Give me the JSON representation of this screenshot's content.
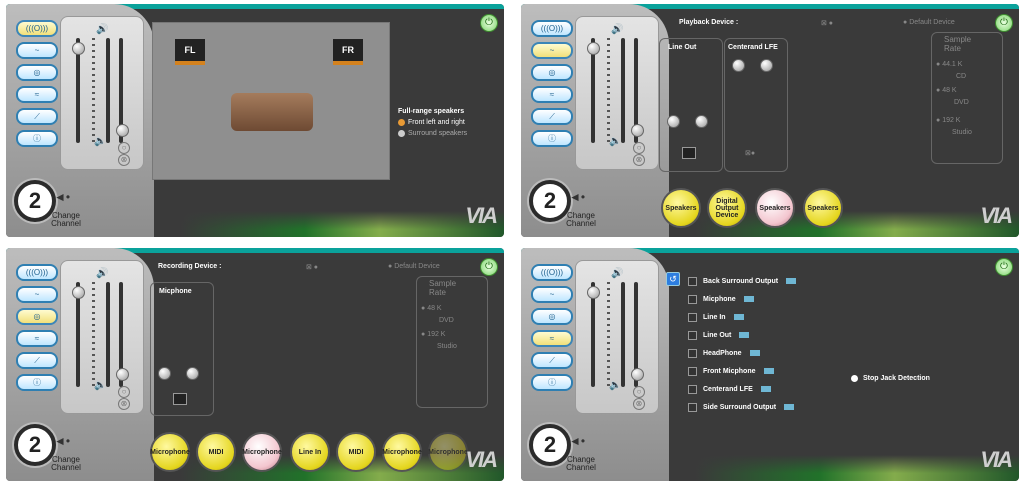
{
  "nav": [
    "(((O)))",
    "~",
    "◎",
    "≈",
    "⟋",
    "ⓘ"
  ],
  "channel": {
    "number": "2",
    "label_line1": "Change",
    "label_line2": "Channel"
  },
  "logo": "VIA",
  "p1": {
    "fl": "FL",
    "fr": "FR",
    "type_title": "Full-range speakers",
    "opt1": "Front left and right",
    "opt2": "Surround speakers"
  },
  "p2": {
    "title": "Playback Device :",
    "default": "Default Device",
    "col1": "Line Out",
    "col2": "Centerand LFE",
    "sample_title_1": "Sample",
    "sample_title_2": "Rate",
    "r1": "44.1 K",
    "r1b": "CD",
    "r2": "48 K",
    "r2b": "DVD",
    "r3": "192 K",
    "r3b": "Studio",
    "balls": [
      "Speakers",
      "Digital Output Device",
      "Speakers",
      "Speakers"
    ]
  },
  "p3": {
    "title": "Recording Device :",
    "default": "Default Device",
    "col1": "Micphone",
    "sample_title_1": "Sample",
    "sample_title_2": "Rate",
    "r1": "48 K",
    "r1b": "DVD",
    "r2": "192 K",
    "r2b": "Studio",
    "balls": [
      "Microphone",
      "MIDI",
      "Microphone",
      "Line In",
      "MIDI",
      "Microphone",
      "Microphone"
    ]
  },
  "p4": {
    "jacks": [
      "Back Surround Output",
      "Micphone",
      "Line In",
      "Line Out",
      "HeadPhone",
      "Front Micphone",
      "Centerand LFE",
      "Side Surround Output"
    ],
    "stop": "Stop Jack Detection"
  }
}
